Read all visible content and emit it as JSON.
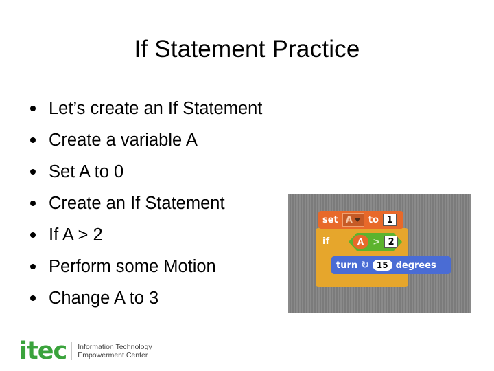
{
  "slide": {
    "title": "If Statement Practice",
    "bullets": [
      "Let’s create an If Statement",
      "Create a variable A",
      "Set A to 0",
      "Create an If Statement",
      "If A > 2",
      "Perform some Motion",
      "Change A to 3"
    ]
  },
  "scratch_script": {
    "set_block": {
      "keyword": "set",
      "variable": "A",
      "to_label": "to",
      "value": "1"
    },
    "if_block": {
      "keyword": "if",
      "condition": {
        "left": "A",
        "operator": ">",
        "right": "2"
      }
    },
    "turn_block": {
      "keyword": "turn",
      "icon": "rotate-clockwise-icon",
      "icon_glyph": "↻",
      "value": "15",
      "unit": "degrees"
    },
    "colors": {
      "set": "#e8692a",
      "control": "#e6a62c",
      "operator": "#5cb32e",
      "motion": "#4a6cd4"
    }
  },
  "footer": {
    "logo_mark": "itec",
    "logo_line1": "Information Technology",
    "logo_line2": "Empowerment Center",
    "brand_color": "#3aa33c"
  }
}
